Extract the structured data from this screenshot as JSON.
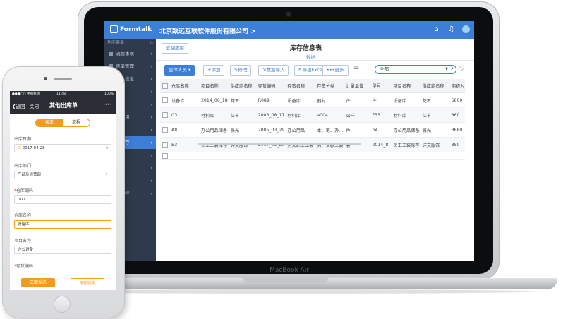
{
  "laptop": {
    "brand_label": "MacBook Air",
    "app": {
      "logo_text": "Formtalk",
      "company": "北京致远互联软件股份有限公司 >",
      "sidebar": {
        "header": "功能菜单",
        "items": [
          {
            "label": "流程事项"
          },
          {
            "label": "表单管理"
          },
          {
            "label": "公共信息"
          },
          {
            "label": "管理"
          },
          {
            "label": ""
          },
          {
            "label": "的应用"
          },
          {
            "label": "管理"
          },
          {
            "label": "进销存"
          },
          {
            "label": "M"
          },
          {
            "label": "管理"
          },
          {
            "label": "管理"
          },
          {
            "label": "库信控"
          }
        ]
      },
      "back_button": "返回应用",
      "page_title": "库存信息表",
      "active_tab": "数据",
      "toolbar": {
        "all_staff": "全体人员 ▾",
        "add": "+添加",
        "edit": "修改",
        "import": "数据导入",
        "export": "导出Excel",
        "more": "更多"
      },
      "search": {
        "value": "全部"
      },
      "table": {
        "columns": [
          "仓库名称",
          "项目名称",
          "供应商名称",
          "存货编码",
          "存货名称",
          "存货分类",
          "计量单位",
          "型号",
          "项目名称",
          "供应商名称",
          "期初入"
        ],
        "rows": [
          [
            "设备库",
            "2014_06_18",
            "花王",
            "R089",
            "设备库",
            "器材",
            "件",
            "件",
            "设备库",
            "花王",
            "5800"
          ],
          [
            "C3",
            "材料库",
            "亿丰",
            "2003_08_17",
            "材料库",
            "a004",
            "公斤",
            "F33",
            "材料库",
            "亿丰",
            "860"
          ],
          [
            "A8",
            "办公用品储备",
            "晨光",
            "2005_03_29",
            "办公用品",
            "本、笔、办...",
            "件",
            "b4",
            "办公用品储备",
            "晨光",
            "3680"
          ],
          [
            "B3",
            "员工工装库存",
            "详文服饰",
            "2017_05_26",
            "男女职工工装",
            "男、女款工装",
            "套",
            "2014_8",
            "员工工装库存",
            "详文服饰",
            "380"
          ]
        ]
      }
    }
  },
  "phone": {
    "status": {
      "carrier": "●●●○○ 中国移动",
      "time": "11:48",
      "battery": "100%"
    },
    "nav": {
      "back": "返回",
      "close": "关闭",
      "title": "其他出库单",
      "more": "•••"
    },
    "segments": [
      "表单",
      "流程"
    ],
    "fields": [
      {
        "label": "出库日期",
        "value": "2017-04-28",
        "required": false
      },
      {
        "label": "出库部门",
        "value": "产品及运营部",
        "required": false
      },
      {
        "label": "仓库编码",
        "value": "000",
        "required": true
      },
      {
        "label": "仓库名称",
        "value": "设备库",
        "required": false
      },
      {
        "label": "项目名称",
        "value": "办公设备",
        "required": false
      },
      {
        "label": "存货编码",
        "value": "",
        "required": true
      }
    ],
    "buttons": {
      "submit": "立即发送",
      "save_draft": "保存待发"
    }
  },
  "colors": {
    "primary": "#3d7fd7",
    "sidebar": "#2f3a4c",
    "accent_orange": "#f29b1d"
  }
}
